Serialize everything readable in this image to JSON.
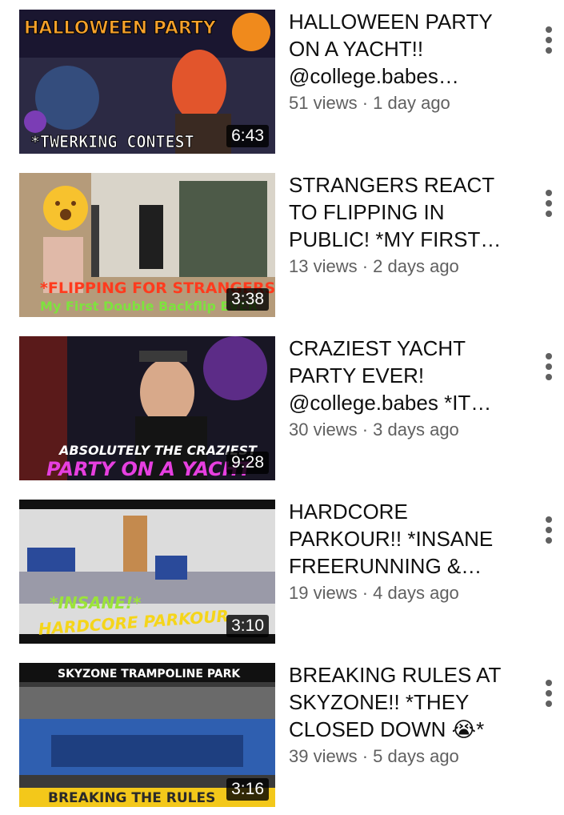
{
  "videos": [
    {
      "title": "HALLOWEEN PARTY ON A YACHT!! @college.babes…",
      "views": "51 views",
      "age": "1 day ago",
      "duration": "6:43",
      "thumb_text_top": "HALLOWEEN PARTY",
      "thumb_text_bottom": "*TWERKING CONTEST"
    },
    {
      "title": "STRANGERS REACT TO FLIPPING IN PUBLIC! *MY FIRST…",
      "views": "13 views",
      "age": "2 days ago",
      "duration": "3:38",
      "thumb_text_top": "*FLIPPING FOR STRANGERS",
      "thumb_text_bottom": "My First Double Backflip EVER"
    },
    {
      "title": "CRAZIEST YACHT PARTY EVER! @college.babes *IT…",
      "views": "30 views",
      "age": "3 days ago",
      "duration": "9:28",
      "thumb_text_top": "ABSOLUTELY THE CRAZIEST",
      "thumb_text_bottom": "PARTY ON A YACHT"
    },
    {
      "title": "HARDCORE PARKOUR!! *INSANE FREERUNNING &…",
      "views": "19 views",
      "age": "4 days ago",
      "duration": "3:10",
      "thumb_text_top": "*INSANE!*",
      "thumb_text_bottom": "HARDCORE PARKOUR"
    },
    {
      "title": "BREAKING RULES AT SKYZONE!! *THEY CLOSED DOWN 😭*",
      "views": "39 views",
      "age": "5 days ago",
      "duration": "3:16",
      "thumb_text_top": "SKYZONE TRAMPOLINE PARK",
      "thumb_text_bottom": "BREAKING THE RULES"
    }
  ],
  "separator": " · ",
  "colors": {
    "title": "#0f0f0f",
    "meta": "#606060",
    "duration_bg": "#000000"
  }
}
